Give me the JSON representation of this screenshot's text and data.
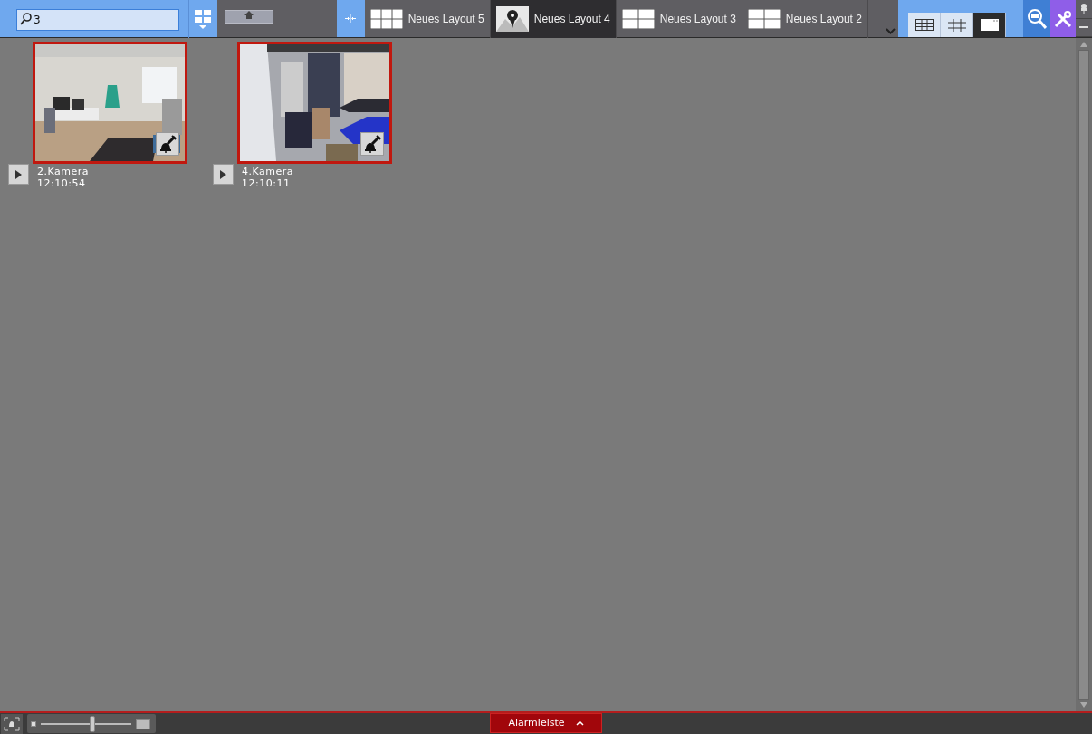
{
  "search": {
    "value": "3"
  },
  "tabs": [
    {
      "label": "Neues Layout 5",
      "selected": false,
      "kind": "grid6"
    },
    {
      "label": "Neues Layout 4",
      "selected": true,
      "kind": "map"
    },
    {
      "label": "Neues Layout 3",
      "selected": false,
      "kind": "grid4"
    },
    {
      "label": "Neues Layout 2",
      "selected": false,
      "kind": "grid4"
    }
  ],
  "view_modes": [
    {
      "kind": "table",
      "selected": false
    },
    {
      "kind": "grid",
      "selected": false
    },
    {
      "kind": "single",
      "selected": true
    }
  ],
  "cameras": [
    {
      "name": "2.Kamera",
      "time": "12:10:54",
      "alarmed": true
    },
    {
      "name": "4.Kamera",
      "time": "12:10:11",
      "alarmed": true
    }
  ],
  "zoom": {
    "level": 0.57
  },
  "alarm_bar": {
    "label": "Alarmleiste"
  }
}
